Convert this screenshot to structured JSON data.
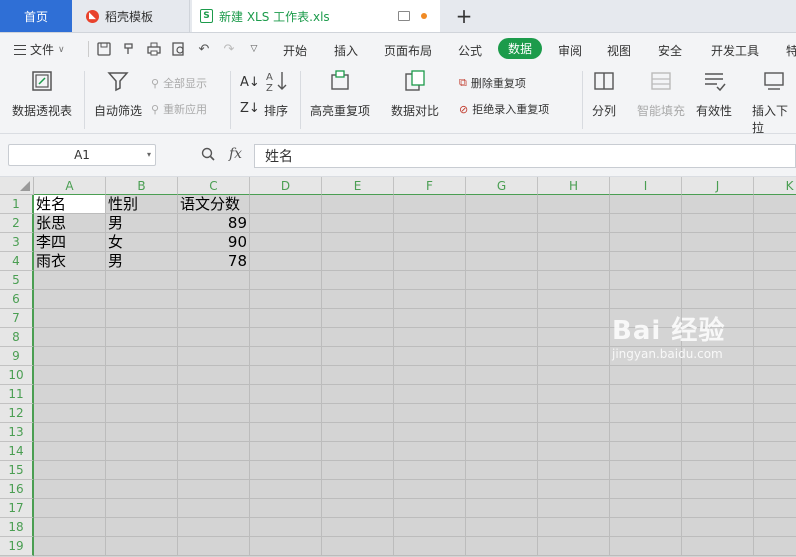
{
  "tabs": {
    "home": "首页",
    "templates": "稻壳模板",
    "file": "新建 XLS 工作表.xls"
  },
  "menu": {
    "file": "文件",
    "tabs": [
      "开始",
      "插入",
      "页面布局",
      "公式",
      "数据",
      "审阅",
      "视图",
      "安全",
      "开发工具",
      "特"
    ],
    "active": "数据"
  },
  "ribbon": {
    "pivot": "数据透视表",
    "auto_filter": "自动筛选",
    "show_all": "全部显示",
    "reapply": "重新应用",
    "sort": "排序",
    "highlight_dup": "高亮重复项",
    "compare": "数据对比",
    "remove_dup": "删除重复项",
    "reject_dup": "拒绝录入重复项",
    "split": "分列",
    "smart_fill": "智能填充",
    "validity": "有效性",
    "insert_dropdown": "插入下拉"
  },
  "formula_bar": {
    "cell_ref": "A1",
    "fx": "fx",
    "value": "姓名"
  },
  "columns": [
    "A",
    "B",
    "C",
    "D",
    "E",
    "F",
    "G",
    "H",
    "I",
    "J",
    "K"
  ],
  "rows": [
    "1",
    "2",
    "3",
    "4",
    "5",
    "6",
    "7",
    "8",
    "9",
    "10",
    "11",
    "12",
    "13",
    "14",
    "15",
    "16",
    "17",
    "18",
    "19"
  ],
  "cells": {
    "A1": "姓名",
    "B1": "性别",
    "C1": "语文分数",
    "A2": "张思",
    "B2": "男",
    "C2": "89",
    "A3": "李四",
    "B3": "女",
    "C3": "90",
    "A4": "雨衣",
    "B4": "男",
    "C4": "78"
  },
  "watermark": {
    "main": "Bai 经验",
    "sub": "jingyan.baidu.com"
  },
  "colors": {
    "accent_green": "#1c9b4b",
    "home_tab_blue": "#2f6fd6",
    "header_green": "#4a9e52",
    "modified_dot": "#f08a24"
  }
}
